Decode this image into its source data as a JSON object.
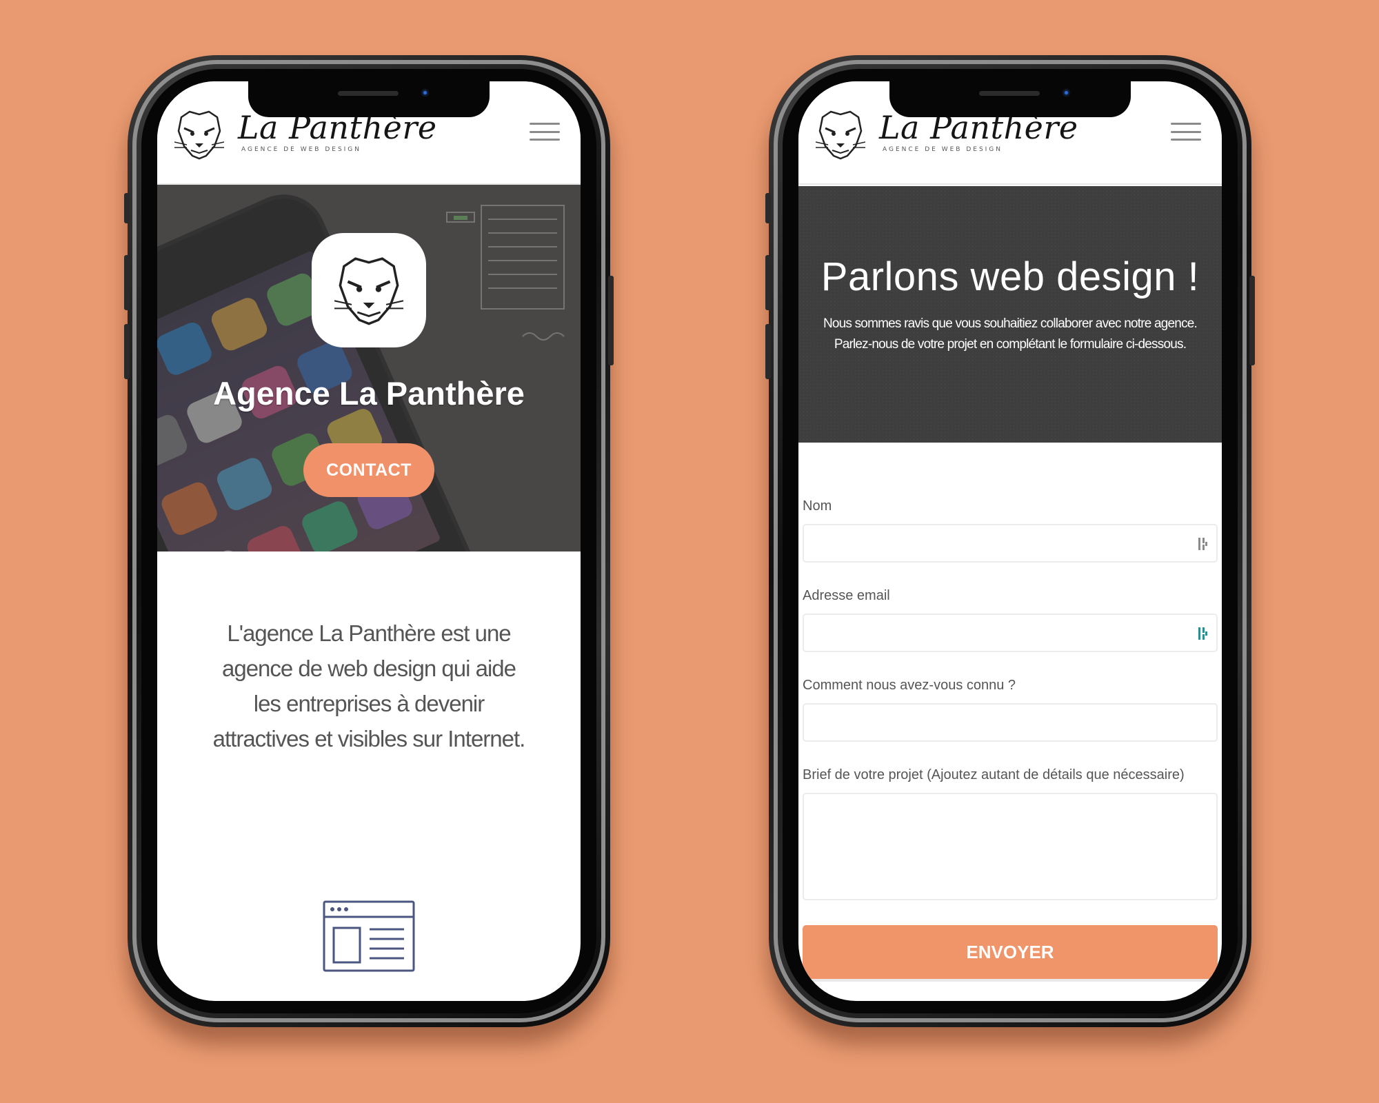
{
  "colors": {
    "background": "#e99a70",
    "accent": "#f0916a",
    "hero_dark": "#3f3e3e"
  },
  "brand": {
    "name": "La Panthère",
    "tagline": "AGENCE DE WEB DESIGN",
    "logo_icon": "panther-head-icon"
  },
  "home": {
    "hero_title": "Agence La Panthère",
    "contact_label": "CONTACT",
    "intro": "L'agence La Panthère est une agence de web design qui aide les entreprises à devenir attractives et visibles sur Internet.",
    "feature_icon": "browser-window-icon"
  },
  "contact": {
    "title": "Parlons web design !",
    "subtitle_1": "Nous sommes ravis que vous souhaitiez collaborer avec notre agence.",
    "subtitle_2": "Parlez-nous de votre projet en complétant le formulaire ci-dessous.",
    "fields": {
      "name_label": "Nom",
      "name_value": "",
      "email_label": "Adresse email",
      "email_value": "",
      "source_label": "Comment nous avez-vous connu ?",
      "source_value": "",
      "brief_label": "Brief de votre projet (Ajoutez autant de détails que nécessaire)",
      "brief_value": ""
    },
    "submit_label": "ENVOYER"
  }
}
